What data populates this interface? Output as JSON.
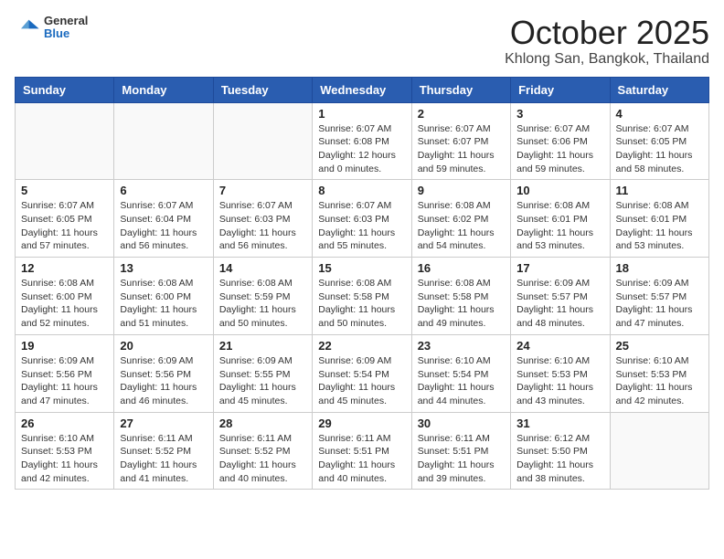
{
  "logo": {
    "general": "General",
    "blue": "Blue"
  },
  "header": {
    "title": "October 2025",
    "subtitle": "Khlong San, Bangkok, Thailand"
  },
  "days_of_week": [
    "Sunday",
    "Monday",
    "Tuesday",
    "Wednesday",
    "Thursday",
    "Friday",
    "Saturday"
  ],
  "weeks": [
    [
      {
        "day": "",
        "sunrise": "",
        "sunset": "",
        "daylight": ""
      },
      {
        "day": "",
        "sunrise": "",
        "sunset": "",
        "daylight": ""
      },
      {
        "day": "",
        "sunrise": "",
        "sunset": "",
        "daylight": ""
      },
      {
        "day": "1",
        "sunrise": "Sunrise: 6:07 AM",
        "sunset": "Sunset: 6:08 PM",
        "daylight": "Daylight: 12 hours and 0 minutes."
      },
      {
        "day": "2",
        "sunrise": "Sunrise: 6:07 AM",
        "sunset": "Sunset: 6:07 PM",
        "daylight": "Daylight: 11 hours and 59 minutes."
      },
      {
        "day": "3",
        "sunrise": "Sunrise: 6:07 AM",
        "sunset": "Sunset: 6:06 PM",
        "daylight": "Daylight: 11 hours and 59 minutes."
      },
      {
        "day": "4",
        "sunrise": "Sunrise: 6:07 AM",
        "sunset": "Sunset: 6:05 PM",
        "daylight": "Daylight: 11 hours and 58 minutes."
      }
    ],
    [
      {
        "day": "5",
        "sunrise": "Sunrise: 6:07 AM",
        "sunset": "Sunset: 6:05 PM",
        "daylight": "Daylight: 11 hours and 57 minutes."
      },
      {
        "day": "6",
        "sunrise": "Sunrise: 6:07 AM",
        "sunset": "Sunset: 6:04 PM",
        "daylight": "Daylight: 11 hours and 56 minutes."
      },
      {
        "day": "7",
        "sunrise": "Sunrise: 6:07 AM",
        "sunset": "Sunset: 6:03 PM",
        "daylight": "Daylight: 11 hours and 56 minutes."
      },
      {
        "day": "8",
        "sunrise": "Sunrise: 6:07 AM",
        "sunset": "Sunset: 6:03 PM",
        "daylight": "Daylight: 11 hours and 55 minutes."
      },
      {
        "day": "9",
        "sunrise": "Sunrise: 6:08 AM",
        "sunset": "Sunset: 6:02 PM",
        "daylight": "Daylight: 11 hours and 54 minutes."
      },
      {
        "day": "10",
        "sunrise": "Sunrise: 6:08 AM",
        "sunset": "Sunset: 6:01 PM",
        "daylight": "Daylight: 11 hours and 53 minutes."
      },
      {
        "day": "11",
        "sunrise": "Sunrise: 6:08 AM",
        "sunset": "Sunset: 6:01 PM",
        "daylight": "Daylight: 11 hours and 53 minutes."
      }
    ],
    [
      {
        "day": "12",
        "sunrise": "Sunrise: 6:08 AM",
        "sunset": "Sunset: 6:00 PM",
        "daylight": "Daylight: 11 hours and 52 minutes."
      },
      {
        "day": "13",
        "sunrise": "Sunrise: 6:08 AM",
        "sunset": "Sunset: 6:00 PM",
        "daylight": "Daylight: 11 hours and 51 minutes."
      },
      {
        "day": "14",
        "sunrise": "Sunrise: 6:08 AM",
        "sunset": "Sunset: 5:59 PM",
        "daylight": "Daylight: 11 hours and 50 minutes."
      },
      {
        "day": "15",
        "sunrise": "Sunrise: 6:08 AM",
        "sunset": "Sunset: 5:58 PM",
        "daylight": "Daylight: 11 hours and 50 minutes."
      },
      {
        "day": "16",
        "sunrise": "Sunrise: 6:08 AM",
        "sunset": "Sunset: 5:58 PM",
        "daylight": "Daylight: 11 hours and 49 minutes."
      },
      {
        "day": "17",
        "sunrise": "Sunrise: 6:09 AM",
        "sunset": "Sunset: 5:57 PM",
        "daylight": "Daylight: 11 hours and 48 minutes."
      },
      {
        "day": "18",
        "sunrise": "Sunrise: 6:09 AM",
        "sunset": "Sunset: 5:57 PM",
        "daylight": "Daylight: 11 hours and 47 minutes."
      }
    ],
    [
      {
        "day": "19",
        "sunrise": "Sunrise: 6:09 AM",
        "sunset": "Sunset: 5:56 PM",
        "daylight": "Daylight: 11 hours and 47 minutes."
      },
      {
        "day": "20",
        "sunrise": "Sunrise: 6:09 AM",
        "sunset": "Sunset: 5:56 PM",
        "daylight": "Daylight: 11 hours and 46 minutes."
      },
      {
        "day": "21",
        "sunrise": "Sunrise: 6:09 AM",
        "sunset": "Sunset: 5:55 PM",
        "daylight": "Daylight: 11 hours and 45 minutes."
      },
      {
        "day": "22",
        "sunrise": "Sunrise: 6:09 AM",
        "sunset": "Sunset: 5:54 PM",
        "daylight": "Daylight: 11 hours and 45 minutes."
      },
      {
        "day": "23",
        "sunrise": "Sunrise: 6:10 AM",
        "sunset": "Sunset: 5:54 PM",
        "daylight": "Daylight: 11 hours and 44 minutes."
      },
      {
        "day": "24",
        "sunrise": "Sunrise: 6:10 AM",
        "sunset": "Sunset: 5:53 PM",
        "daylight": "Daylight: 11 hours and 43 minutes."
      },
      {
        "day": "25",
        "sunrise": "Sunrise: 6:10 AM",
        "sunset": "Sunset: 5:53 PM",
        "daylight": "Daylight: 11 hours and 42 minutes."
      }
    ],
    [
      {
        "day": "26",
        "sunrise": "Sunrise: 6:10 AM",
        "sunset": "Sunset: 5:53 PM",
        "daylight": "Daylight: 11 hours and 42 minutes."
      },
      {
        "day": "27",
        "sunrise": "Sunrise: 6:11 AM",
        "sunset": "Sunset: 5:52 PM",
        "daylight": "Daylight: 11 hours and 41 minutes."
      },
      {
        "day": "28",
        "sunrise": "Sunrise: 6:11 AM",
        "sunset": "Sunset: 5:52 PM",
        "daylight": "Daylight: 11 hours and 40 minutes."
      },
      {
        "day": "29",
        "sunrise": "Sunrise: 6:11 AM",
        "sunset": "Sunset: 5:51 PM",
        "daylight": "Daylight: 11 hours and 40 minutes."
      },
      {
        "day": "30",
        "sunrise": "Sunrise: 6:11 AM",
        "sunset": "Sunset: 5:51 PM",
        "daylight": "Daylight: 11 hours and 39 minutes."
      },
      {
        "day": "31",
        "sunrise": "Sunrise: 6:12 AM",
        "sunset": "Sunset: 5:50 PM",
        "daylight": "Daylight: 11 hours and 38 minutes."
      },
      {
        "day": "",
        "sunrise": "",
        "sunset": "",
        "daylight": ""
      }
    ]
  ]
}
